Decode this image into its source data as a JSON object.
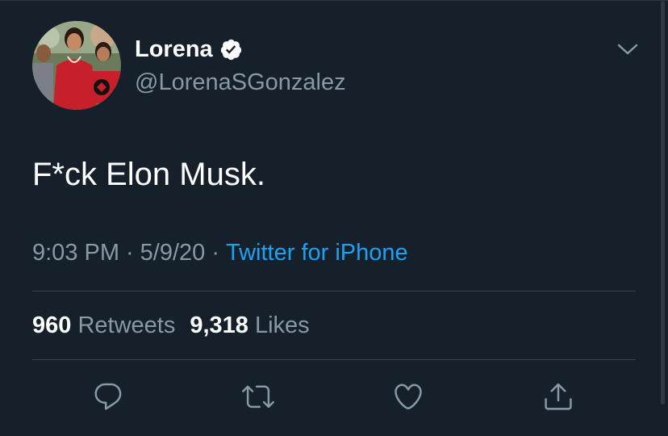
{
  "tweet": {
    "display_name": "Lorena",
    "handle": "@LorenaSGonzalez",
    "text": "F*ck Elon Musk.",
    "time": "9:03 PM",
    "date": "5/9/20",
    "separator": "·",
    "source": "Twitter for iPhone",
    "retweets_count": "960",
    "retweets_label": "Retweets",
    "likes_count": "9,318",
    "likes_label": "Likes"
  },
  "icons": {
    "verified": "verified-badge-icon",
    "more": "chevron-down-icon",
    "reply": "reply-icon",
    "retweet": "retweet-icon",
    "like": "heart-icon",
    "share": "share-icon"
  },
  "colors": {
    "background": "#15202b",
    "text_primary": "#ffffff",
    "text_secondary": "#8899a6",
    "link": "#1da1f2",
    "divider": "#38444d"
  }
}
